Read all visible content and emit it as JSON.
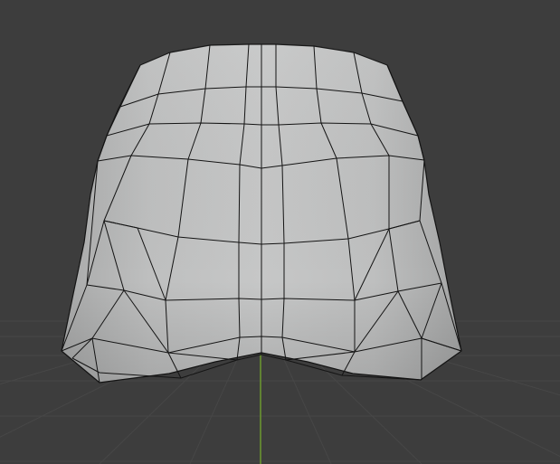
{
  "viewport": {
    "view": "front-orthographic-perspective",
    "background_color": "#3d3d3d",
    "grid_color": "#4a4a4a",
    "z_axis_color": "#6c9a2e",
    "mesh_fill_color": "#c2c3c3",
    "wire_color": "#141414"
  },
  "mesh": {
    "object": "mesh-object",
    "shading": "solid",
    "overlay": "wireframe"
  }
}
